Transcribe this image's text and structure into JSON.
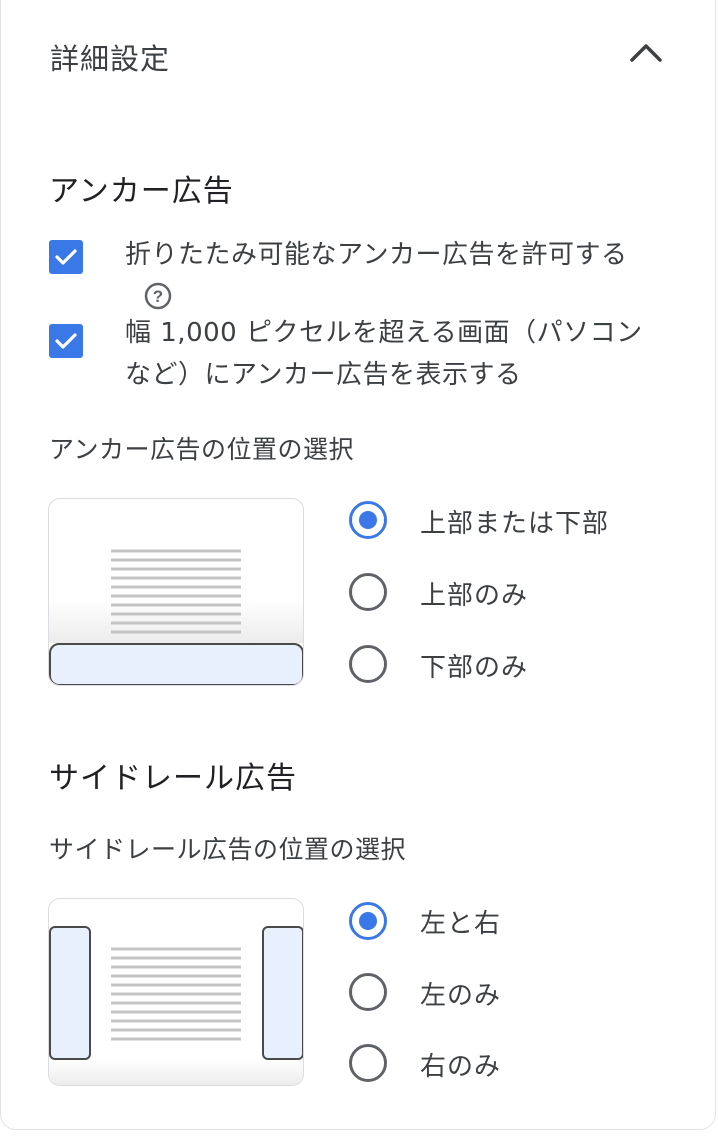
{
  "header": {
    "title": "詳細設定"
  },
  "anchor": {
    "title": "アンカー広告",
    "checkboxes": [
      {
        "label": "折りたたみ可能なアンカー広告を許可する",
        "checked": true
      },
      {
        "label_line1": "幅 1,000 ピクセルを超える画面（パソコン",
        "label_line2": "など）にアンカー広告を表示する",
        "checked": true
      }
    ],
    "position_label": "アンカー広告の位置の選択",
    "options": [
      {
        "label": "上部または下部",
        "selected": true
      },
      {
        "label": "上部のみ",
        "selected": false
      },
      {
        "label": "下部のみ",
        "selected": false
      }
    ]
  },
  "siderail": {
    "title": "サイドレール広告",
    "position_label": "サイドレール広告の位置の選択",
    "options": [
      {
        "label": "左と右",
        "selected": true
      },
      {
        "label": "左のみ",
        "selected": false
      },
      {
        "label": "右のみ",
        "selected": false
      }
    ]
  },
  "colors": {
    "accent": "#3b78e7",
    "text": "#3c4043",
    "ad_fill": "#e8effd"
  },
  "icons": {
    "collapse": "chevron-up-icon",
    "help": "help-circle-icon",
    "check": "check-icon"
  }
}
